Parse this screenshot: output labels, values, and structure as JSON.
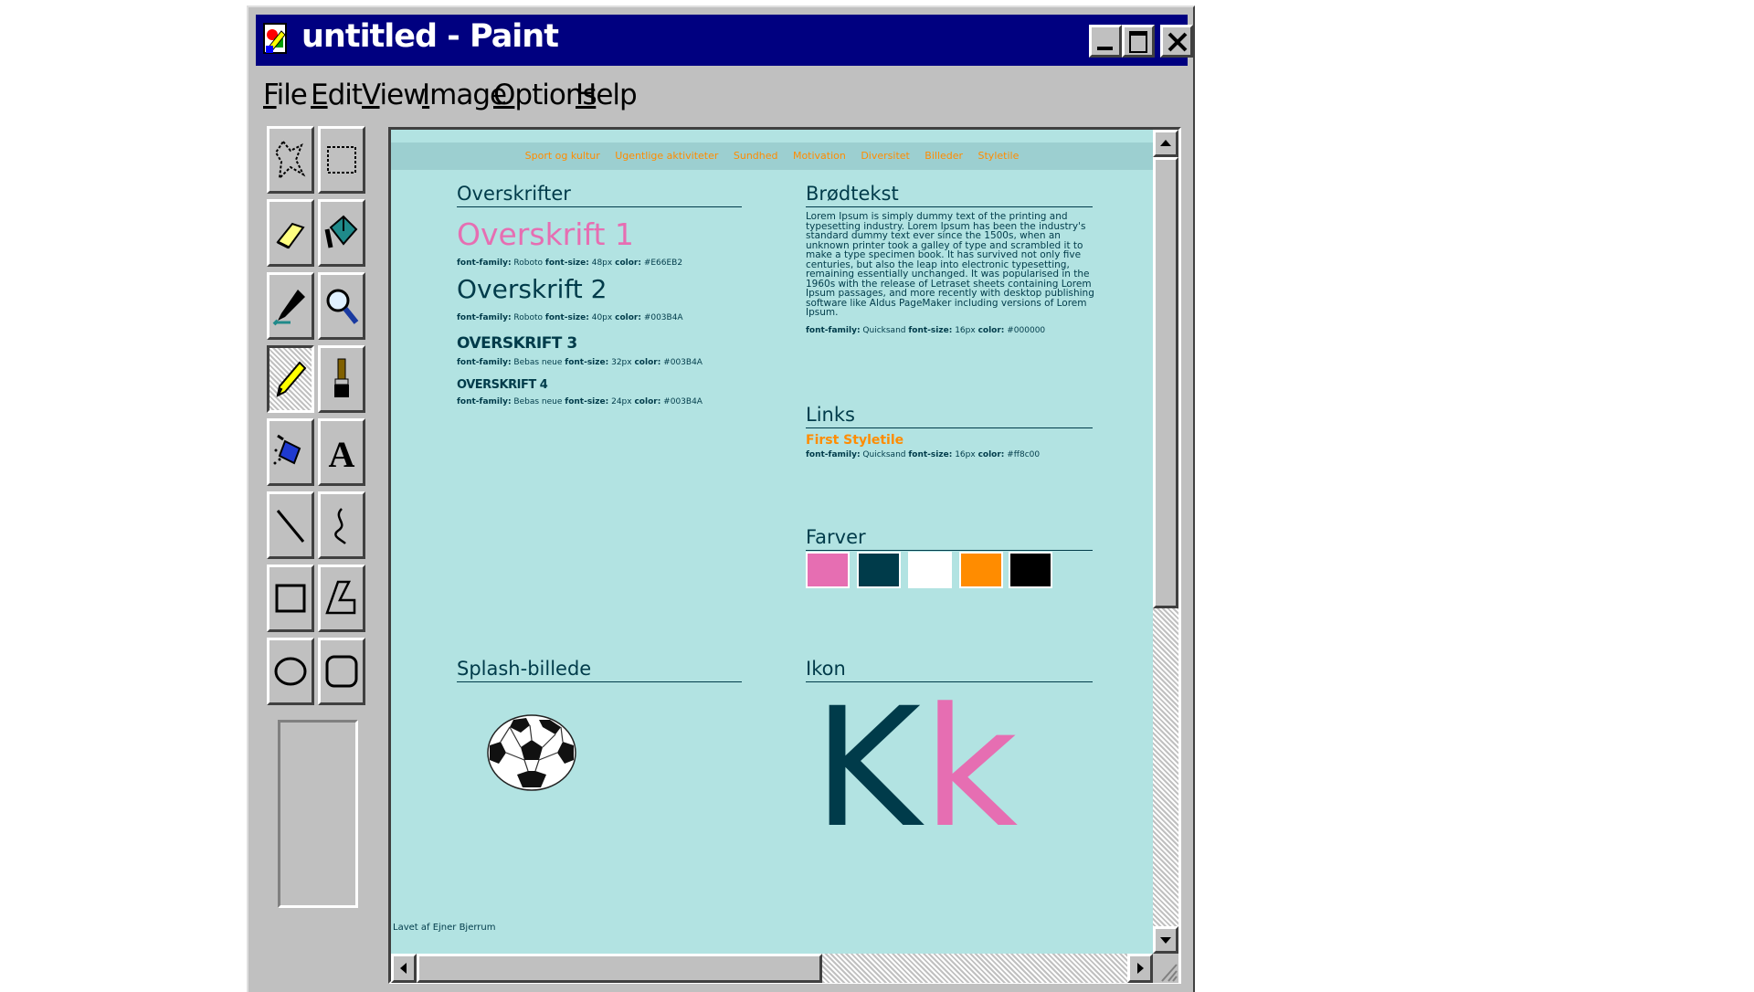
{
  "window": {
    "title": "untitled - Paint",
    "buttons": [
      "minimize",
      "maximize",
      "close"
    ]
  },
  "menu": {
    "items": [
      {
        "accel": "F",
        "rest": "ile"
      },
      {
        "accel": "E",
        "rest": "dit"
      },
      {
        "accel": "V",
        "rest": "iew"
      },
      {
        "accel": "I",
        "rest": "mage"
      },
      {
        "accel": "O",
        "rest": "ptions"
      },
      {
        "accel": "H",
        "rest": "elp"
      }
    ]
  },
  "toolbox": {
    "tools": [
      "free-form-select",
      "rectangle-select",
      "eraser",
      "fill-with-color",
      "pick-color",
      "magnifier",
      "pencil",
      "brush",
      "airbrush",
      "text",
      "line",
      "curve",
      "rectangle",
      "polygon",
      "ellipse",
      "rounded-rectangle"
    ],
    "selected": "pencil"
  },
  "site": {
    "nav": [
      "Sport og kultur",
      "Ugentlige aktiviteter",
      "Sundhed",
      "Motivation",
      "Diversitet",
      "Billeder",
      "Styletile"
    ],
    "headings_section": {
      "title": "Overskrifter",
      "h1": "Overskrift 1",
      "h1_spec": {
        "label1": "font-family:",
        "val1": "Roboto",
        "label2": "font-size:",
        "val2": "48px",
        "label3": "color:",
        "val3": "#E66EB2"
      },
      "h2": "Overskrift 2",
      "h2_spec": {
        "label1": "font-family:",
        "val1": "Roboto",
        "label2": "font-size:",
        "val2": "40px",
        "label3": "color:",
        "val3": "#003B4A"
      },
      "h3": "OVERSKRIFT 3",
      "h3_spec": {
        "label1": "font-family:",
        "val1": "Bebas neue",
        "label2": "font-size:",
        "val2": "32px",
        "label3": "color:",
        "val3": "#003B4A"
      },
      "h4": "OVERSKRIFT 4",
      "h4_spec": {
        "label1": "font-family:",
        "val1": "Bebas neue",
        "label2": "font-size:",
        "val2": "24px",
        "label3": "color:",
        "val3": "#003B4A"
      }
    },
    "body_section": {
      "title": "Brødtekst",
      "text": "Lorem Ipsum is simply dummy text of the printing and typesetting industry. Lorem Ipsum has been the industry's standard dummy text ever since the 1500s, when an unknown printer took a galley of type and scrambled it to make a type specimen book. It has survived not only five centuries, but also the leap into electronic typesetting, remaining essentially unchanged. It was popularised in the 1960s with the release of Letraset sheets containing Lorem Ipsum passages, and more recently with desktop publishing software like Aldus PageMaker including versions of Lorem Ipsum.",
      "spec": {
        "label1": "font-family:",
        "val1": "Quicksand",
        "label2": "font-size:",
        "val2": "16px",
        "label3": "color:",
        "val3": "#000000"
      }
    },
    "links_section": {
      "title": "Links",
      "sample": "First Styletile",
      "spec": {
        "label1": "font-family:",
        "val1": "Quicksand",
        "label2": "font-size:",
        "val2": "16px",
        "label3": "color:",
        "val3": "#ff8c00"
      }
    },
    "colors_section": {
      "title": "Farver",
      "swatches": [
        "#E66EB2",
        "#003B4A",
        "#FFFFFF",
        "#FF8C00",
        "#000000"
      ]
    },
    "splash_section": {
      "title": "Splash-billede",
      "image": "soccer-ball"
    },
    "icon_section": {
      "title": "Ikon",
      "letters": [
        {
          "char": "K",
          "color": "#003B4A"
        },
        {
          "char": "k",
          "color": "#E66EB2"
        }
      ]
    },
    "footer": "Lavet af Ejner Bjerrum"
  }
}
